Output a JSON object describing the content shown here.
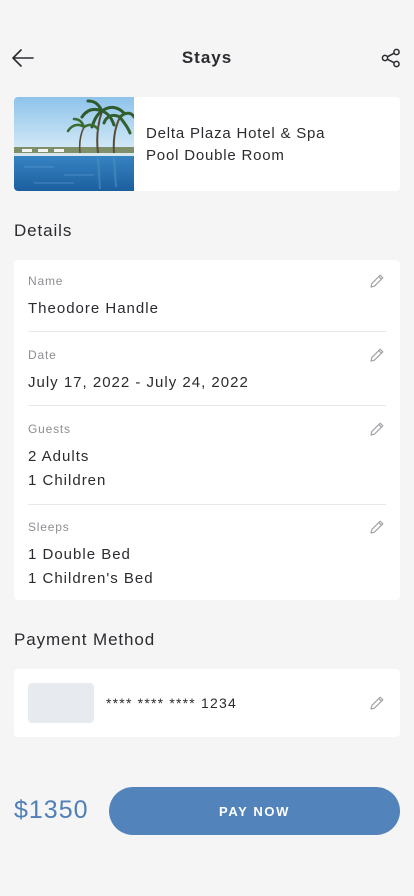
{
  "header": {
    "title": "Stays",
    "back_icon": "arrow-left-icon",
    "share_icon": "share-icon"
  },
  "stay": {
    "hotel_name": "Delta Plaza Hotel & Spa",
    "room_type": "Pool Double Room"
  },
  "details": {
    "section_title": "Details",
    "name": {
      "label": "Name",
      "value": "Theodore Handle"
    },
    "date": {
      "label": "Date",
      "value": "July 17, 2022 - July 24, 2022"
    },
    "guests": {
      "label": "Guests",
      "line1": "2 Adults",
      "line2": "1 Children"
    },
    "sleeps": {
      "label": "Sleeps",
      "line1": "1 Double Bed",
      "line2": "1 Children's Bed"
    },
    "edit_icon": "pencil-icon"
  },
  "payment": {
    "section_title": "Payment Method",
    "card_number": "**** **** **** 1234"
  },
  "checkout": {
    "price": "$1350",
    "pay_label": "PAY NOW"
  },
  "colors": {
    "accent": "#5383bb",
    "price": "#4f7fb7",
    "background": "#f5f5f6"
  }
}
